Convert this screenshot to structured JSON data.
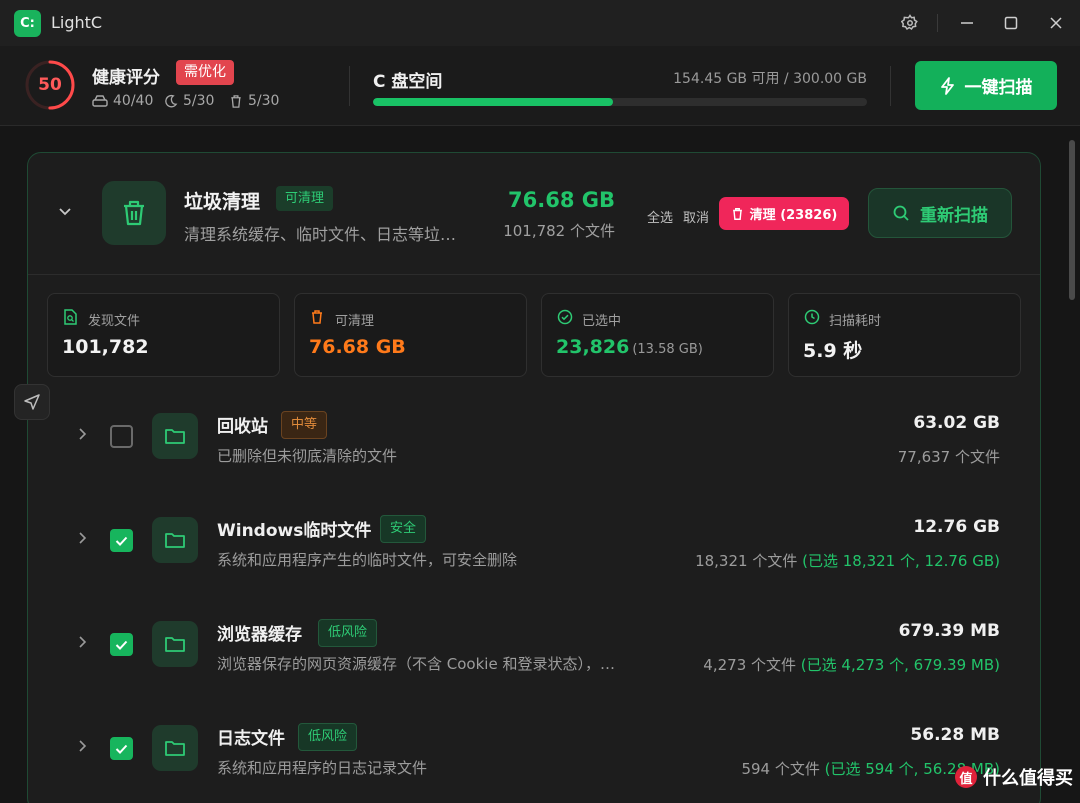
{
  "app": {
    "logo_text": "C:",
    "title": "LightC"
  },
  "header": {
    "score": "50",
    "score_fraction": 0.5,
    "health_title": "健康评分",
    "health_badge": "需优化",
    "stats": [
      "40/40",
      "5/30",
      "5/30"
    ],
    "disk_title": "C 盘空间",
    "disk_info": "154.45 GB 可用 / 300.00 GB",
    "disk_used_fraction": 0.4852,
    "scan_label": "一键扫描"
  },
  "category": {
    "title": "垃圾清理",
    "badge": "可清理",
    "desc": "清理系统缓存、临时文件、日志等垃…",
    "size": "76.68 GB",
    "files": "101,782 个文件",
    "select_all": "全选",
    "cancel": "取消",
    "clean_label": "清理 (23826)",
    "rescan_label": "重新扫描"
  },
  "stats": [
    {
      "label": "发现文件",
      "value": "101,782",
      "sub": "",
      "color": "#f2f2f2",
      "icon_color": "#2ecb75"
    },
    {
      "label": "可清理",
      "value": "76.68 GB",
      "sub": "",
      "color": "#ff7a1a",
      "icon_color": "#ff7a1a"
    },
    {
      "label": "已选中",
      "value": "23,826",
      "sub": "(13.58 GB)",
      "color": "#22c46a",
      "icon_color": "#2ecb75"
    },
    {
      "label": "扫描耗时",
      "value": "5.9 秒",
      "sub": "",
      "color": "#f2f2f2",
      "icon_color": "#2ecb75"
    }
  ],
  "items": [
    {
      "title": "回收站",
      "risk": "中等",
      "desc": "已删除但未彻底清除的文件",
      "size": "63.02 GB",
      "files": "77,637 个文件",
      "selected": "",
      "checked": false
    },
    {
      "title": "Windows临时文件",
      "risk": "安全",
      "desc": "系统和应用程序产生的临时文件，可安全删除",
      "size": "12.76 GB",
      "files": "18,321 个文件 ",
      "selected": "(已选 18,321 个, 12.76 GB)",
      "checked": true
    },
    {
      "title": "浏览器缓存",
      "risk": "低风险",
      "desc": "浏览器保存的网页资源缓存（不含 Cookie 和登录状态），…",
      "size": "679.39 MB",
      "files": "4,273 个文件 ",
      "selected": "(已选 4,273 个, 679.39 MB)",
      "checked": true
    },
    {
      "title": "日志文件",
      "risk": "低风险",
      "desc": "系统和应用程序的日志记录文件",
      "size": "56.28 MB",
      "files": "594 个文件 ",
      "selected": "(已选 594 个, 56.28 MB)",
      "checked": true
    }
  ],
  "watermark": {
    "logo": "值",
    "text": "什么值得买"
  }
}
